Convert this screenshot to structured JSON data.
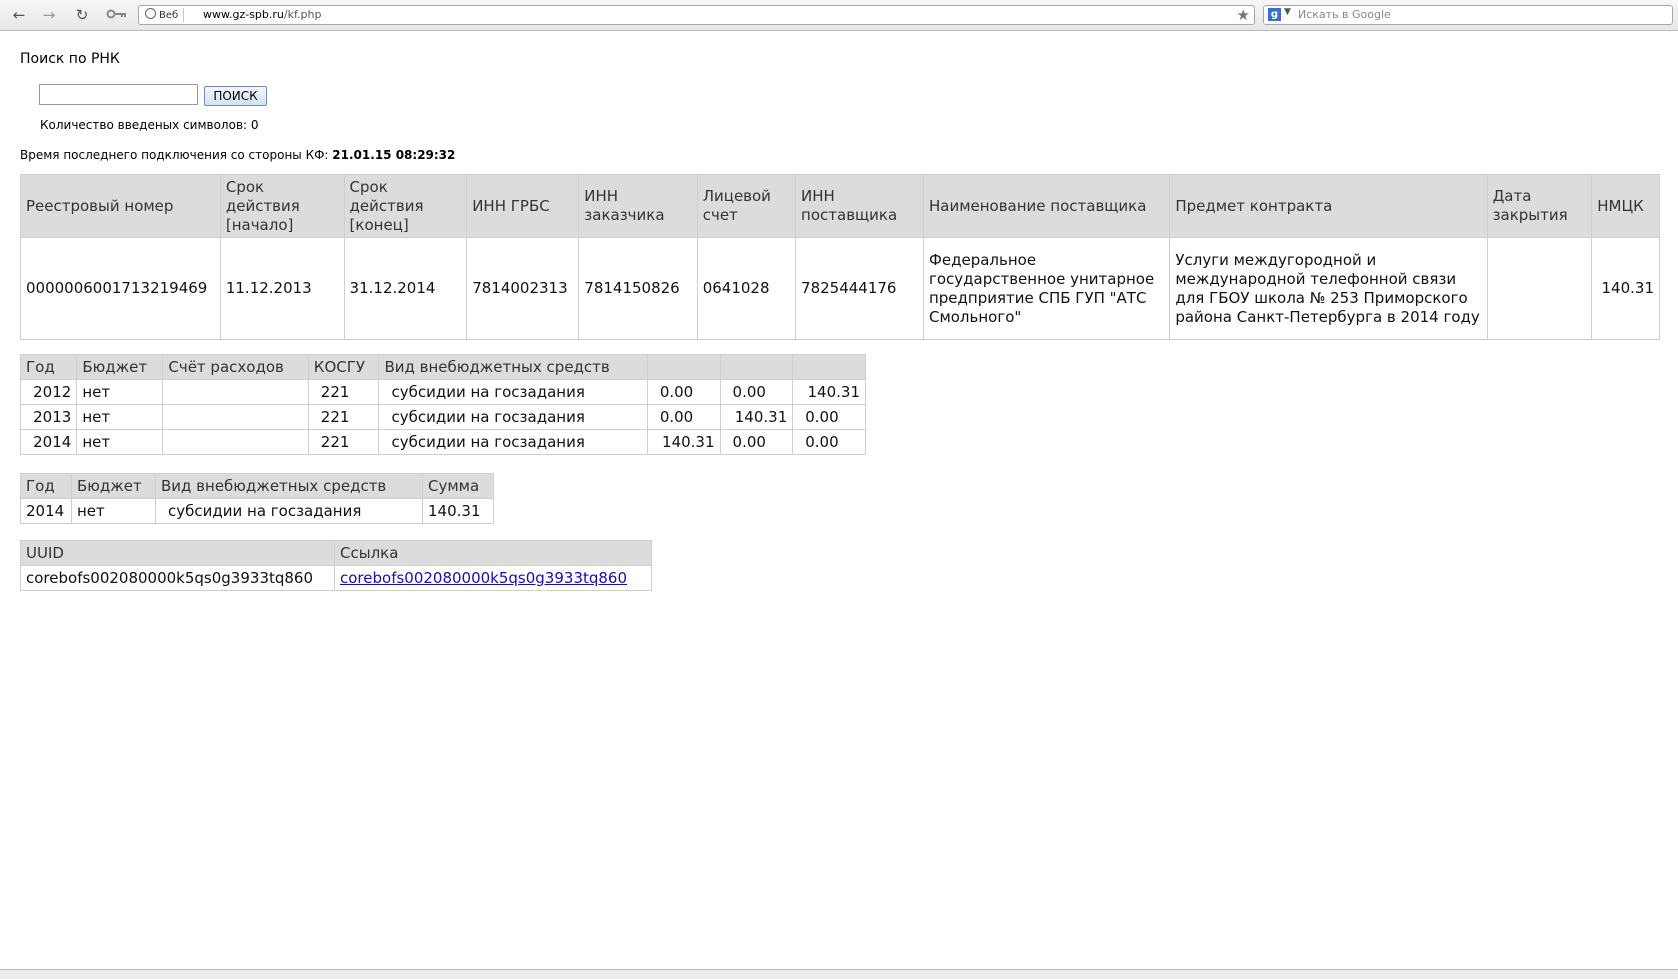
{
  "browser": {
    "identity_label": "Веб",
    "url_host": "www.gz-spb.ru",
    "url_path": "/kf.php",
    "search_placeholder": "Искать в Google"
  },
  "page": {
    "title": "Поиск по РНК",
    "search_value": "",
    "search_button": "ПОИСК",
    "char_count": "Количество введеных символов: 0",
    "last_connection_label": "Время последнего подключения со стороны КФ:",
    "last_connection_value": "21.01.15 08:29:32"
  },
  "main_table": {
    "headers": [
      "Реестровый номер",
      "Срок действия [начало]",
      "Срок действия [конец]",
      "ИНН ГРБС",
      "ИНН заказчика",
      "Лицевой счет",
      "ИНН поставщика",
      "Наименование поставщика",
      "Предмет контракта",
      "Дата закрытия",
      "НМЦК"
    ],
    "row": [
      "0000006001713219469",
      "11.12.2013",
      "31.12.2014",
      "7814002313",
      "7814150826",
      "0641028",
      "7825444176",
      "Федеральное государственное унитарное предприятие СПБ ГУП \"АТС Смольного\"",
      "Услуги междугородной и международной телефонной связи для ГБОУ школа № 253 Приморского района Санкт-Петербурга в 2014 году",
      "",
      "140.31"
    ]
  },
  "finance_table": {
    "headers": [
      "Год",
      "Бюджет",
      "Счёт расходов",
      "КОСГУ",
      "Вид внебюджетных средств",
      "",
      "",
      ""
    ],
    "rows": [
      [
        "2012",
        "нет",
        "",
        "221",
        "субсидии на госзадания",
        "0.00",
        "0.00",
        "140.31"
      ],
      [
        "2013",
        "нет",
        "",
        "221",
        "субсидии на госзадания",
        "0.00",
        "140.31",
        "0.00"
      ],
      [
        "2014",
        "нет",
        "",
        "221",
        "субсидии на госзадания",
        "140.31",
        "0.00",
        "0.00"
      ]
    ]
  },
  "sum_table": {
    "headers": [
      "Год",
      "Бюджет",
      "Вид внебюджетных средств",
      "Сумма"
    ],
    "row": [
      "2014",
      "нет",
      "субсидии на госзадания",
      "140.31"
    ]
  },
  "link_table": {
    "headers": [
      "UUID",
      "Ссылка"
    ],
    "row": [
      "corebofs002080000k5qs0g3933tq860",
      "corebofs002080000k5qs0g3933tq860"
    ]
  },
  "icons": [
    "back-arrow-icon",
    "forward-arrow-icon",
    "reload-icon",
    "key-icon",
    "globe-icon",
    "bookmark-star-icon",
    "google-icon"
  ]
}
